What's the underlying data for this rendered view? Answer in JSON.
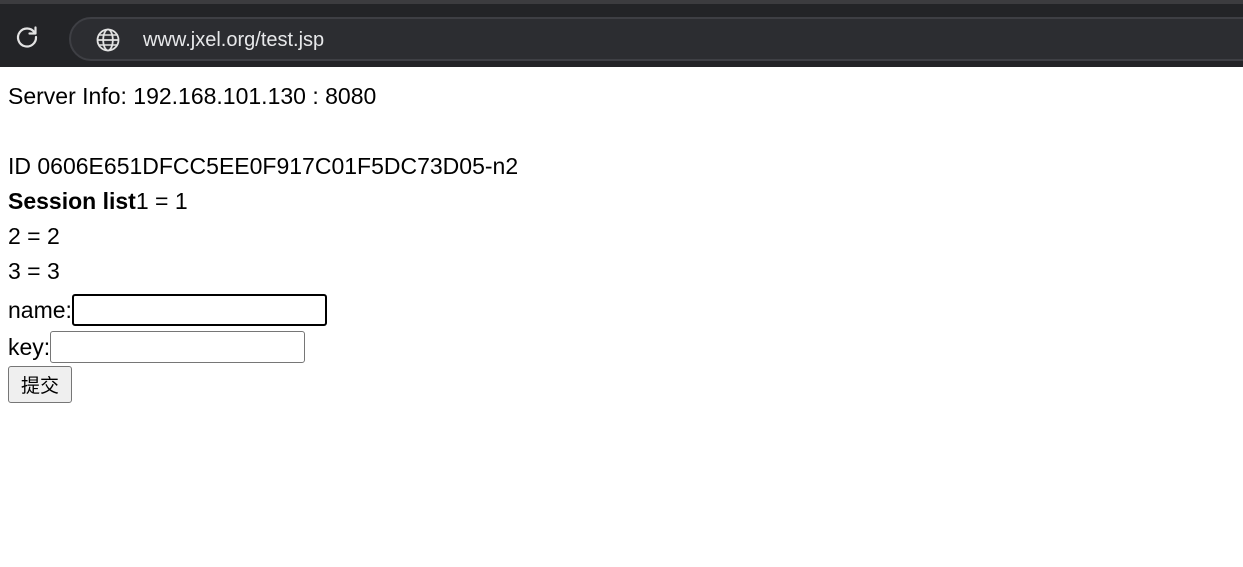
{
  "browser": {
    "url": "www.jxel.org/test.jsp",
    "reload_icon": "reload-icon",
    "site_icon": "globe-icon"
  },
  "page": {
    "server_info": "Server Info: 192.168.101.130 : 8080",
    "session_id": "ID 0606E651DFCC5EE0F917C01F5DC73D05-n2",
    "session_list_label": "Session list",
    "session_items": [
      "1 = 1",
      "2 = 2",
      "3 = 3"
    ],
    "name_label": "name:",
    "name_value": "",
    "key_label": "key:",
    "key_value": "",
    "submit_label": "提交"
  }
}
